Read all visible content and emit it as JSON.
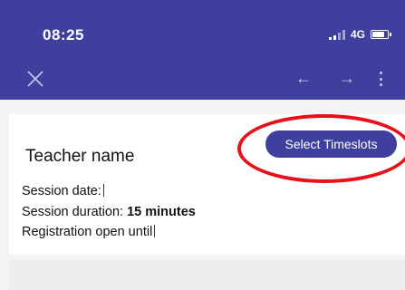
{
  "status_bar": {
    "time": "08:25",
    "network": "4G"
  },
  "toolbar": {
    "icons": [
      "close-icon",
      "arrow-left-icon",
      "arrow-right-icon",
      "more-vert-icon"
    ],
    "back_glyph": "←",
    "forward_glyph": "→"
  },
  "card": {
    "teacher_name": "Teacher name",
    "select_button_label": "Select Timeslots",
    "session_date_label": "Session date:",
    "session_duration_label": "Session duration:",
    "session_duration_value": "15 minutes",
    "registration_label": "Registration open until"
  },
  "colors": {
    "primary": "#3f3f9e",
    "highlight_circle": "#e8101a"
  }
}
